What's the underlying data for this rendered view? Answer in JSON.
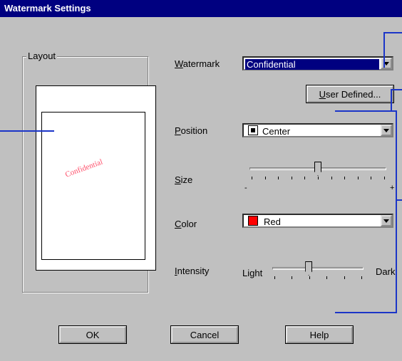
{
  "window": {
    "title": "Watermark Settings"
  },
  "layout_group": {
    "label": "Layout",
    "preview_watermark": "Confidential"
  },
  "watermark": {
    "label_prefix": "W",
    "label_rest": "atermark",
    "selected": "Confidential"
  },
  "user_defined_button": {
    "prefix": "U",
    "rest": "ser Defined..."
  },
  "position": {
    "label_prefix": "P",
    "label_rest": "osition",
    "selected": "Center"
  },
  "size": {
    "label_prefix": "S",
    "label_rest": "ize",
    "min_mark": "-",
    "max_mark": "+",
    "level": 0.5
  },
  "color": {
    "label_prefix": "C",
    "label_rest": "olor",
    "selected": "Red",
    "swatch": "#ff0000"
  },
  "intensity": {
    "label_prefix": "I",
    "label_rest": "ntensity",
    "left_label": "Light",
    "right_label": "Dark",
    "level": 0.4
  },
  "buttons": {
    "ok": "OK",
    "cancel": "Cancel",
    "help": "Help"
  },
  "colors": {
    "title_bar": "#000080",
    "callout_lines": "#1b35c8",
    "dialog_face": "#c0c0c0"
  }
}
